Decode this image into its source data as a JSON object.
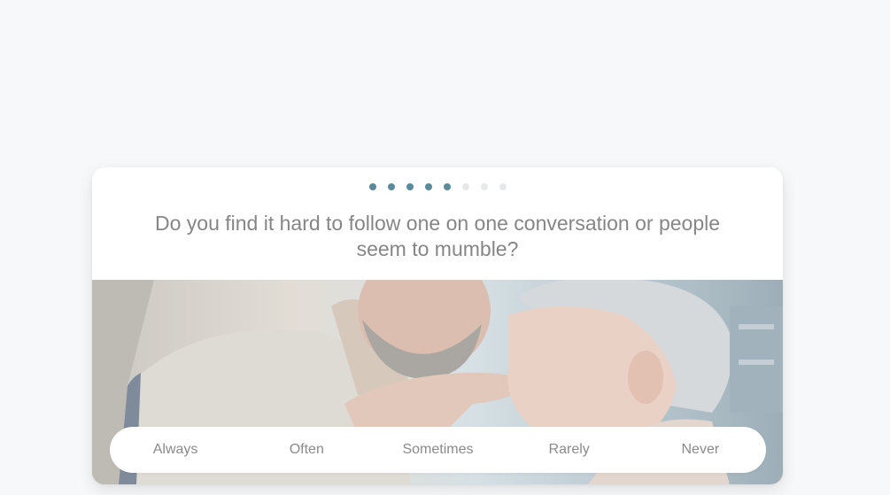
{
  "progress": {
    "total_steps": 8,
    "completed_steps": 5,
    "active_color": "#5b8a9a",
    "inactive_color": "#e6e8ea"
  },
  "question": {
    "text": "Do you find it hard to follow one on one conversation or people seem to mumble?"
  },
  "image": {
    "description_icon": "photo-couple-icon"
  },
  "answers": [
    {
      "label": "Always"
    },
    {
      "label": "Often"
    },
    {
      "label": "Sometimes"
    },
    {
      "label": "Rarely"
    },
    {
      "label": "Never"
    }
  ]
}
